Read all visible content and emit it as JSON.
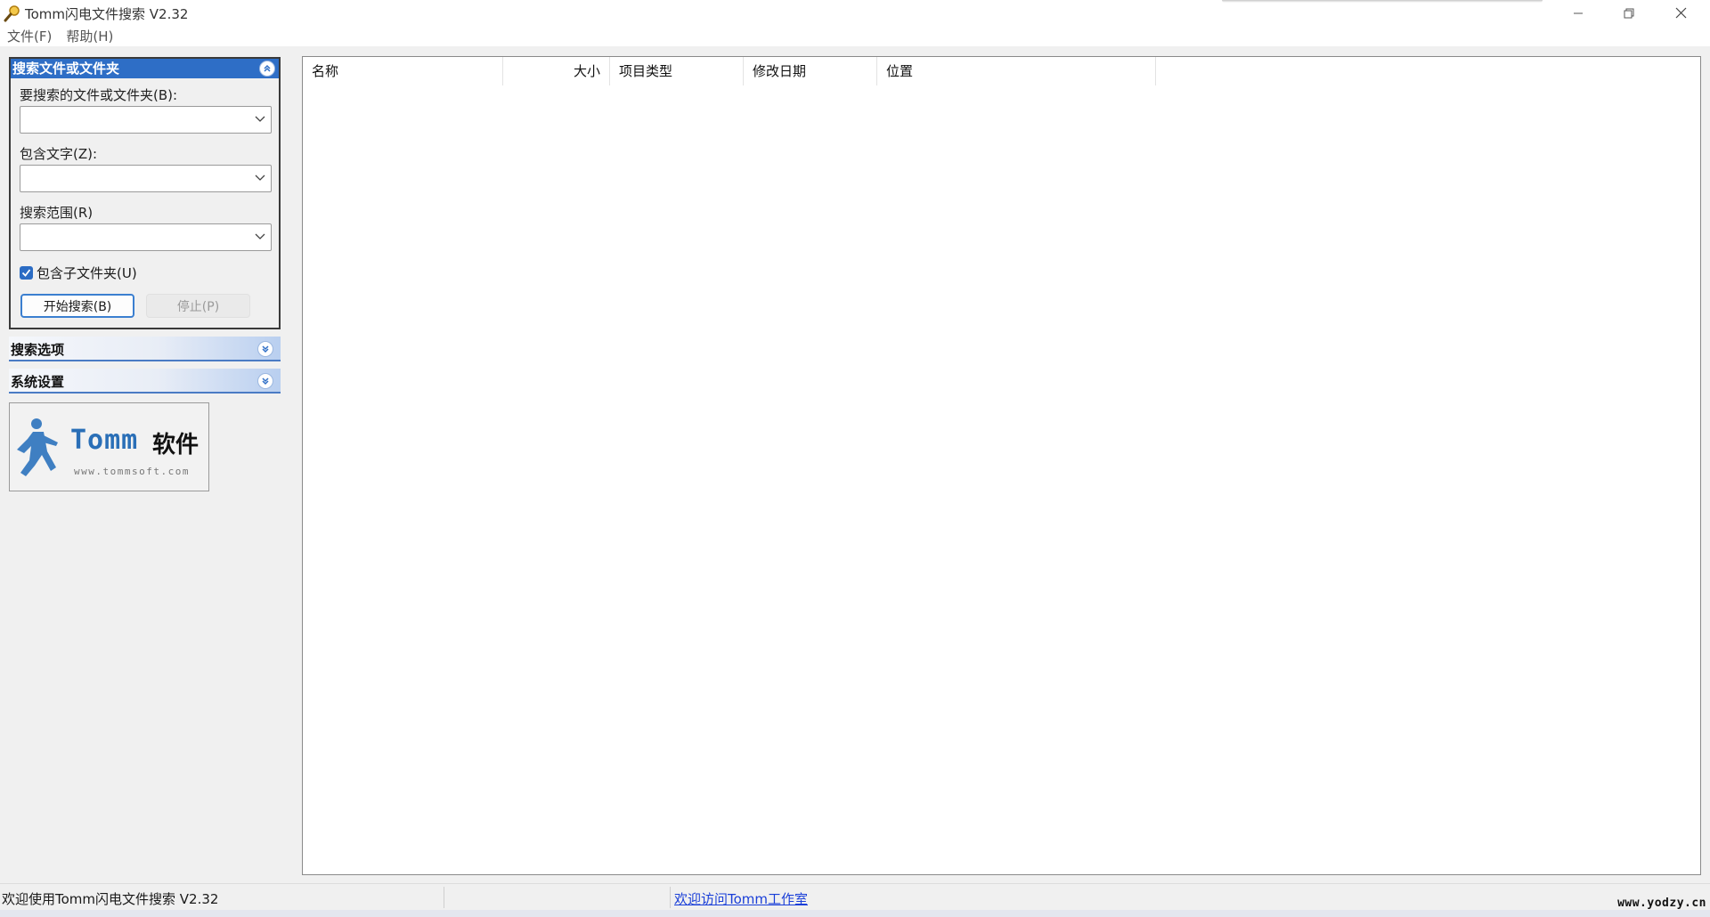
{
  "window": {
    "title": "Tomm闪电文件搜索 V2.32"
  },
  "menu": {
    "items": [
      "文件(F)",
      "帮助(H)"
    ]
  },
  "search_panel": {
    "header": "搜索文件或文件夹",
    "file_label": "要搜索的文件或文件夹(B):",
    "file_value": "",
    "text_label": "包含文字(Z):",
    "text_value": "",
    "scope_label": "搜索范围(R)",
    "scope_value": "",
    "include_subfolders_label": "包含子文件夹(U)",
    "include_subfolders_checked": true,
    "start_button": "开始搜索(B)",
    "stop_button": "停止(P)"
  },
  "options_panel": {
    "header": "搜索选项"
  },
  "settings_panel": {
    "header": "系统设置"
  },
  "logo": {
    "name": "Tomm",
    "cn_suffix": "软件",
    "url": "www.tommsoft.com"
  },
  "results": {
    "columns": [
      "名称",
      "大小",
      "项目类型",
      "修改日期",
      "位置"
    ],
    "rows": []
  },
  "status": {
    "message": "欢迎使用Tomm闪电文件搜索 V2.32",
    "link": "欢迎访问Tomm工作室"
  },
  "watermark": "www.yodzy.cn",
  "colors": {
    "panel_header_active": "#2e6ec6",
    "link": "#1a3fd8",
    "accent": "#3b7fd0"
  }
}
